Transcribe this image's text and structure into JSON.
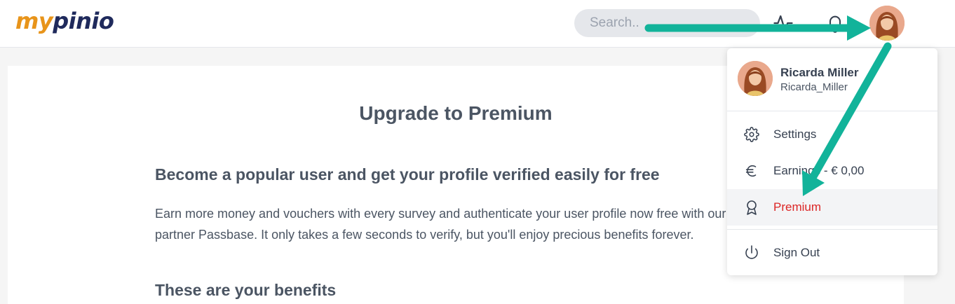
{
  "header": {
    "logo_part1": "my",
    "logo_part2": "pinio",
    "search_placeholder": "Search.."
  },
  "main": {
    "title": "Upgrade to Premium",
    "subtitle": "Become a popular user and get your profile verified easily for free",
    "paragraph": "Earn more money and vouchers with every survey and authenticate your user profile now free with our partner Passbase. It only takes a few seconds to verify, but you'll enjoy precious benefits forever.",
    "benefits_heading": "These are your benefits"
  },
  "user_menu": {
    "name": "Ricarda Miller",
    "username": "Ricarda_Miller",
    "items": [
      {
        "label": "Settings",
        "icon": "gear-icon"
      },
      {
        "label": "Earnings - € 0,00",
        "icon": "euro-icon"
      },
      {
        "label": "Premium",
        "icon": "award-icon",
        "active": true
      },
      {
        "label": "Sign Out",
        "icon": "power-icon"
      }
    ]
  },
  "colors": {
    "logo_orange": "#e8941a",
    "logo_navy": "#1f2a5c",
    "accent_red": "#dc2626",
    "arrow_teal": "#12b39a"
  }
}
